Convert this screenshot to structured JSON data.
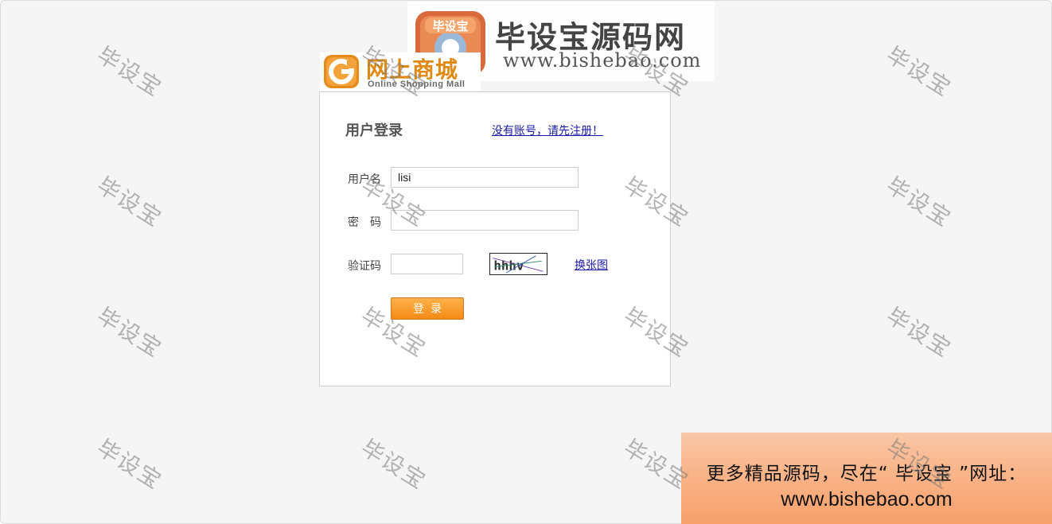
{
  "brand": {
    "mascot_text": "毕设宝",
    "title": "毕设宝源码网",
    "url": "www.bishebao.com"
  },
  "shop_logo": {
    "cn": "网上商城",
    "en": "Online Shopping Mall"
  },
  "login": {
    "title": "用户登录",
    "register_link": "没有账号，请先注册！",
    "username_label": "用户名",
    "username_value": "lisi",
    "password_label": "密　码",
    "password_value": "",
    "captcha_label": "验证码",
    "captcha_value": "",
    "captcha_text": "hhhv",
    "captcha_refresh": "换张图",
    "submit_label": "登录"
  },
  "watermark": "毕设宝",
  "promo": {
    "line1": "更多精品源码，尽在“ 毕设宝 ”网址：",
    "line2": "www.bishebao.com"
  },
  "colors": {
    "accent_orange": "#f58a16",
    "link_blue": "#1a1aa6",
    "brand_orange": "#e08a14"
  }
}
